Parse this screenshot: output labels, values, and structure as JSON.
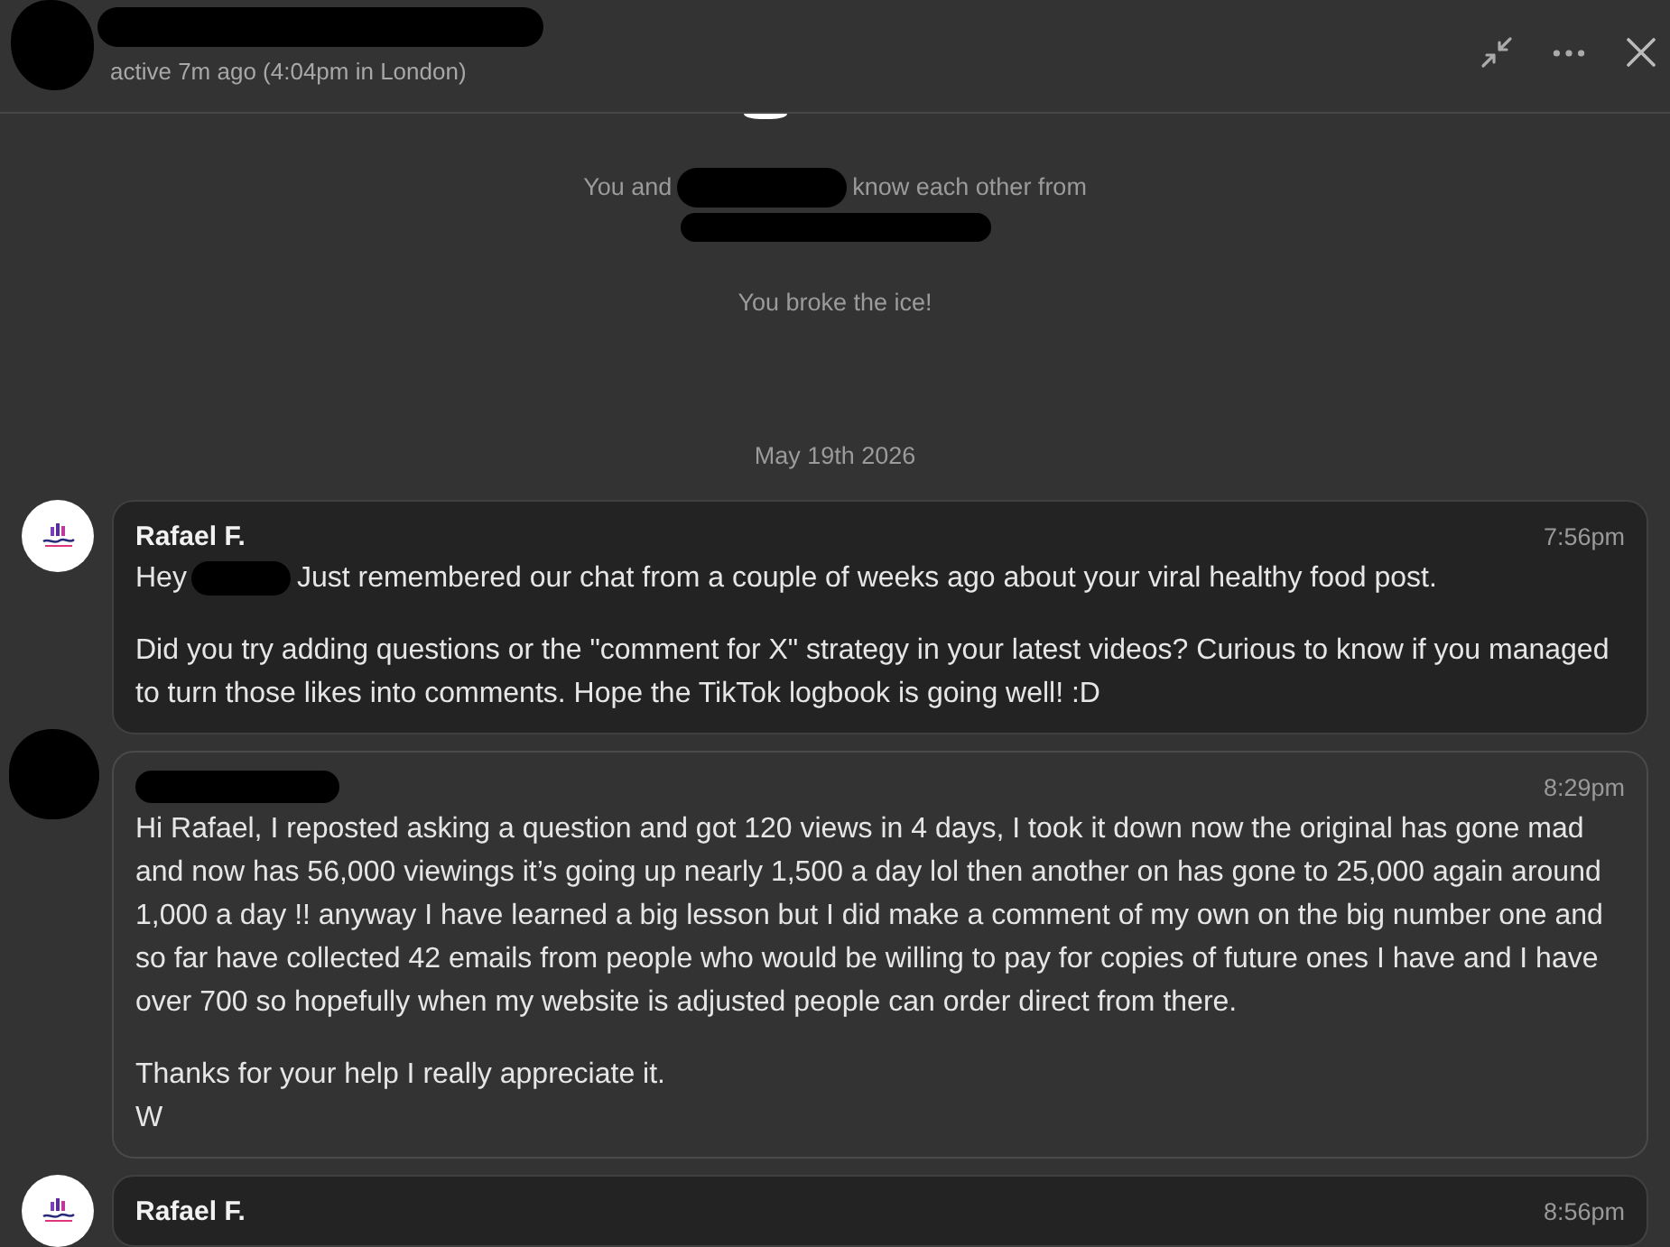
{
  "header": {
    "status": "active 7m ago (4:04pm in London)"
  },
  "notes": [
    {
      "segments": [
        "You and",
        "know each other from"
      ],
      "redacted_line": true
    },
    {
      "segments": [
        "You broke the ice!"
      ]
    }
  ],
  "date": "May 19th 2026",
  "messages": [
    {
      "kind": "sent",
      "sender": "Rafael F.",
      "time": "7:56pm",
      "paragraphs": [
        [
          "Hey",
          "Just remembered our chat from a couple of weeks ago about your viral healthy food post."
        ],
        [
          "Did you try adding questions or the \"comment for X\" strategy in your latest videos? Curious to know if you managed to turn those likes into comments. Hope the TikTok logbook is going well! :D"
        ]
      ]
    },
    {
      "kind": "received",
      "time": "8:29pm",
      "paragraphs": [
        [
          "Hi Rafael, I reposted asking a question and got 120 views in 4 days, I took it down now the original has gone mad and now has 56,000 viewings it’s going up nearly 1,500 a day lol then another on has gone to 25,000 again around 1,000 a day !! anyway I have learned a big lesson but I did make a comment of my own on the big number one and so far have collected 42 emails from people who would be willing to pay for copies of future ones I have and I have over 700 so hopefully when my website is adjusted people can order direct from there."
        ],
        [
          "Thanks for your help I really appreciate it.\nW"
        ]
      ]
    },
    {
      "kind": "sent",
      "sender": "Rafael F.",
      "time": "8:56pm"
    }
  ]
}
